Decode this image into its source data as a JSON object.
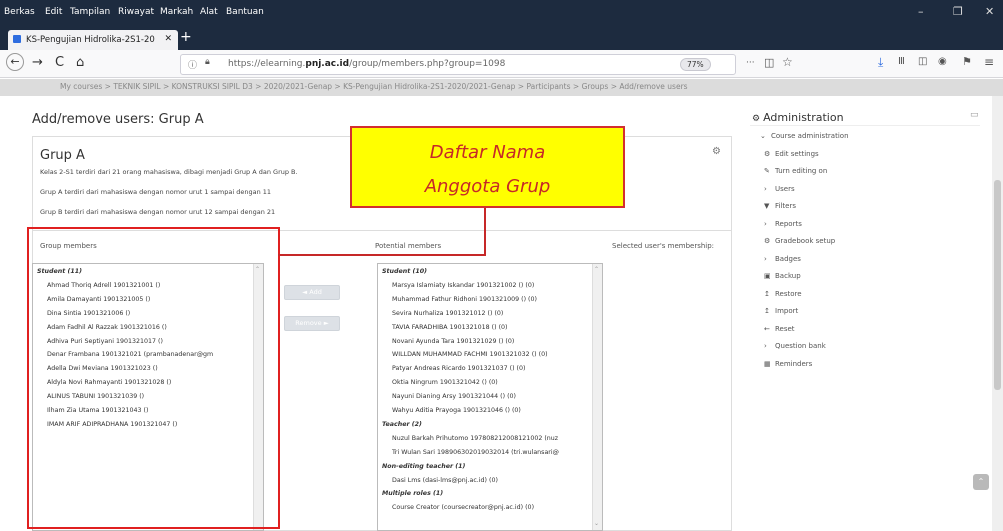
{
  "browser": {
    "menu": [
      "Berkas",
      "Edit",
      "Tampilan",
      "Riwayat",
      "Markah",
      "Alat",
      "Bantuan"
    ],
    "window_controls": {
      "minimize": "–",
      "maximize": "❐",
      "close": "✕"
    },
    "tab": {
      "title": "KS-Pengujian Hidrolika-2S1-20",
      "close": "✕"
    },
    "new_tab": "+",
    "url": {
      "prefix": "https://elearning.",
      "domain": "pnj.ac.id",
      "path": "/group/members.php?group=1098"
    },
    "zoom": "77%",
    "nav": {
      "back": "←",
      "forward": "→",
      "reload": "C",
      "home": "⌂"
    }
  },
  "breadcrumb": "My courses > TEKNIK SIPIL > KONSTRUKSI SIPIL D3 > 2020/2021-Genap > KS-Pengujian Hidrolika-2S1-2020/2021-Genap > Participants > Groups > Add/remove users",
  "page": {
    "heading": "Add/remove users: Grup A",
    "group_title": "Grup A",
    "desc": [
      "Kelas 2-S1 terdiri dari 21 orang mahasiswa, dibagi menjadi Grup A dan Grup B.",
      "Grup A terdiri dari mahasiswa dengan nomor urut 1 sampai dengan 11",
      "Grup B terdiri dari mahasiswa dengan nomor urut 12 sampai dengan 21"
    ]
  },
  "columns": {
    "group_members": "Group members",
    "potential_members": "Potential members",
    "selected_membership": "Selected user's membership:"
  },
  "group_members": [
    {
      "text": "Student (11)",
      "group": true
    },
    {
      "text": "Ahmad Thoriq Adrell 1901321001 ()"
    },
    {
      "text": "Amila Damayanti 1901321005 ()"
    },
    {
      "text": "Dina Sintia 1901321006 ()"
    },
    {
      "text": "Adam Fadhil Al Razzak 1901321016 ()"
    },
    {
      "text": "Adhiva Puri Septiyani 1901321017 ()"
    },
    {
      "text": "Denar Frambana 1901321021 (prambanadenar@gm"
    },
    {
      "text": "Adella Dwi Meviana 1901321023 ()"
    },
    {
      "text": "Aldyla Novi Rahmayanti 1901321028 ()"
    },
    {
      "text": "ALINUS TABUNI 1901321039 ()"
    },
    {
      "text": "Ilham Zia Utama 1901321043 ()"
    },
    {
      "text": "IMAM ARIF ADIPRADHANA 1901321047 ()"
    }
  ],
  "buttons": {
    "add": "◄ Add",
    "remove": "Remove ►"
  },
  "potential_members": [
    {
      "text": "Student (10)",
      "group": true
    },
    {
      "text": "Marsya Islamiaty Iskandar 1901321002 () (0)"
    },
    {
      "text": "Muhammad Fathur Ridhoni 1901321009 () (0)"
    },
    {
      "text": "Sevira Nurhaliza 1901321012 () (0)"
    },
    {
      "text": "TAVIA FARADHIBA 1901321018 () (0)"
    },
    {
      "text": "Novani Ayunda Tara 1901321029 () (0)"
    },
    {
      "text": "WILLDAN MUHAMMAD FACHMI 1901321032 () (0)"
    },
    {
      "text": "Patyar Andreas Ricardo 1901321037 () (0)"
    },
    {
      "text": "Oktia Ningrum 1901321042 () (0)"
    },
    {
      "text": "Nayuni Dianing Arsy 1901321044 () (0)"
    },
    {
      "text": "Wahyu Aditia Prayoga 1901321046 () (0)"
    },
    {
      "text": "Teacher (2)",
      "group": true
    },
    {
      "text": "Nuzul Barkah Prihutomo 197808212008121002 (nuz"
    },
    {
      "text": "Tri Wulan Sari 198906302019032014 (tri.wulansari@"
    },
    {
      "text": "Non-editing teacher (1)",
      "group": true
    },
    {
      "text": "Dasi Lms (dasi-lms@pnj.ac.id) (0)"
    },
    {
      "text": "Multiple roles (1)",
      "group": true
    },
    {
      "text": "Course Creator (coursecreator@pnj.ac.id) (0)"
    }
  ],
  "annotation": {
    "line1": "Daftar Nama",
    "line2": "Anggota Grup"
  },
  "admin": {
    "title": "Administration",
    "items": [
      {
        "icon": "⌄",
        "label": "Course administration",
        "icon_name": "chevron-down-icon"
      },
      {
        "icon": "⚙",
        "label": "Edit settings",
        "icon_name": "gear-icon"
      },
      {
        "icon": "✎",
        "label": "Turn editing on",
        "icon_name": "pencil-icon"
      },
      {
        "icon": "›",
        "label": "Users",
        "icon_name": "chevron-right-icon"
      },
      {
        "icon": "▼",
        "label": "Filters",
        "icon_name": "filter-icon"
      },
      {
        "icon": "›",
        "label": "Reports",
        "icon_name": "chevron-right-icon"
      },
      {
        "icon": "⚙",
        "label": "Gradebook setup",
        "icon_name": "gear-icon"
      },
      {
        "icon": "›",
        "label": "Badges",
        "icon_name": "chevron-right-icon"
      },
      {
        "icon": "▣",
        "label": "Backup",
        "icon_name": "backup-icon"
      },
      {
        "icon": "↥",
        "label": "Restore",
        "icon_name": "restore-icon"
      },
      {
        "icon": "↥",
        "label": "Import",
        "icon_name": "import-icon"
      },
      {
        "icon": "←",
        "label": "Reset",
        "icon_name": "reset-icon"
      },
      {
        "icon": "›",
        "label": "Question bank",
        "icon_name": "chevron-right-icon"
      },
      {
        "icon": "▦",
        "label": "Reminders",
        "icon_name": "calendar-icon"
      }
    ]
  },
  "colors": {
    "annotation_border": "#e02020",
    "callout_bg": "#ffff00",
    "callout_text": "#c62828",
    "titlebar": "#1d2b3f"
  }
}
